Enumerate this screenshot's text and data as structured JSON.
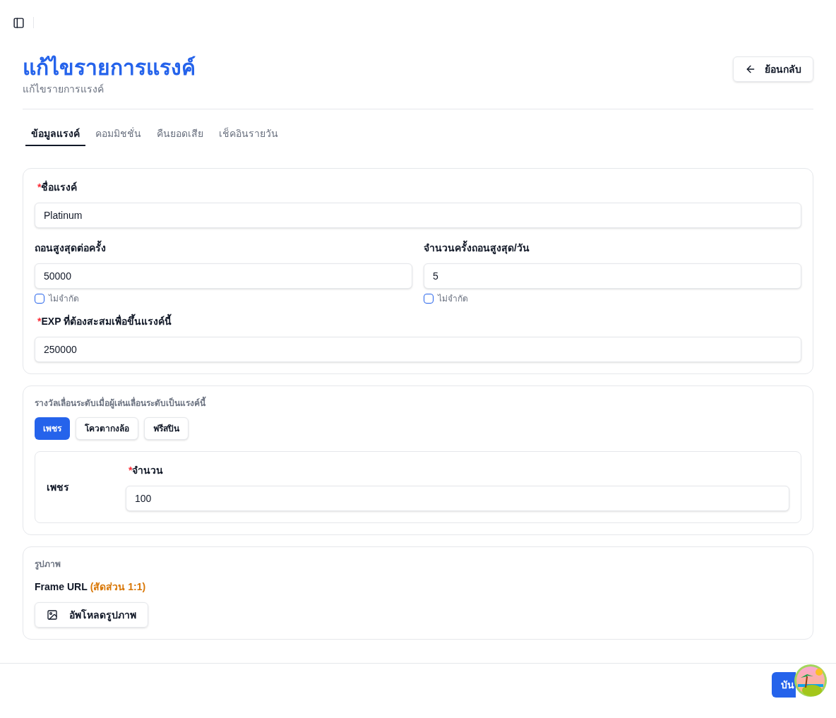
{
  "header": {
    "title": "แก้ไขรายการแรงค์",
    "subtitle": "แก้ไขรายการแรงค์",
    "back_button": "ย้อนกลับ"
  },
  "tabs": [
    {
      "label": "ข้อมูลแรงค์",
      "selected": true
    },
    {
      "label": "คอมมิชชั่น",
      "selected": false
    },
    {
      "label": "คืนยอดเสีย",
      "selected": false
    },
    {
      "label": "เช็คอินรายวัน",
      "selected": false
    }
  ],
  "rank_form": {
    "name": {
      "label": "ชื่อแรงค์",
      "required_mark": "*",
      "value": "Platinum"
    },
    "limits": [
      {
        "label": "ถอนสูงสุดต่อครั้ง",
        "value": "50000",
        "checkbox_label": "ไม่จำกัด",
        "checked": false
      },
      {
        "label": "จำนวนครั้งถอนสูงสุด/วัน",
        "value": "5",
        "checkbox_label": "ไม่จำกัด",
        "checked": false
      }
    ],
    "exp": {
      "label": "EXP ที่ต้องสะสมเพื่อขึ้นแรงค์นี้",
      "required_mark": "*",
      "value": "250000"
    }
  },
  "rewards": {
    "title": "รางวัลเลื่อนระดับเมื่อผู้เล่นเลื่อนระดับเป็นแรงค์นี้",
    "types": [
      {
        "label": "เพชร",
        "selected": true
      },
      {
        "label": "โควตากงล้อ",
        "selected": false
      },
      {
        "label": "ฟรีสปิน",
        "selected": false
      }
    ],
    "detail": {
      "name": "เพชร",
      "field_label": "จำนวน",
      "required_mark": "*",
      "value": "100"
    }
  },
  "image": {
    "title": "รูปภาพ",
    "label": "Frame URL",
    "hint": "(สัดส่วน 1:1)",
    "upload_button": "อัพโหลดรูปภาพ"
  },
  "footer": {
    "save_button": "บัน"
  }
}
